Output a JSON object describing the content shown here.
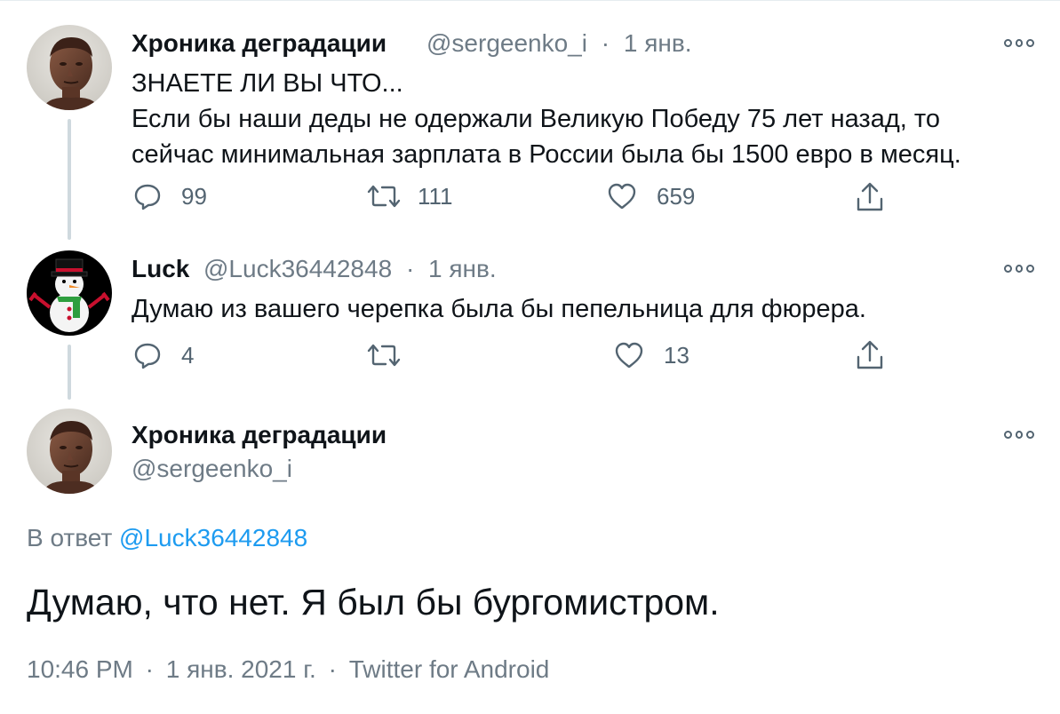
{
  "tweet1": {
    "author_name": "Хроника деградации",
    "handle": "@sergeenko_i",
    "separator": "·",
    "date": "1 янв.",
    "lines": [
      "ЗНАЕТЕ ЛИ ВЫ ЧТО...",
      "Если бы наши деды не одержали Великую Победу 75 лет назад, то",
      "сейчас минимальная зарплата в России была бы 1500 евро в месяц."
    ],
    "replies": "99",
    "retweets": "111",
    "likes": "659"
  },
  "tweet2": {
    "author_name": "Luck",
    "handle": "@Luck36442848",
    "separator": "·",
    "date": "1 янв.",
    "lines": [
      "Думаю из вашего черепка была бы пепельница для фюрера."
    ],
    "replies": "4",
    "retweets": "",
    "likes": "13"
  },
  "tweet3": {
    "author_name": "Хроника деградации",
    "handle": "@sergeenko_i",
    "reply_prefix": "В ответ",
    "reply_handle": "@Luck36442848",
    "text": "Думаю, что нет. Я был бы бургомистром.",
    "time": "10:46 PM",
    "date": "1 янв. 2021 г.",
    "client": "Twitter for Android",
    "separator": "·"
  },
  "colors": {
    "text": "#0f1419",
    "secondary": "#6e7b86",
    "link": "#1d9bf0",
    "thread_line": "#cfd9de"
  },
  "icons": [
    "more-icon",
    "reply-icon",
    "retweet-icon",
    "like-icon",
    "share-icon"
  ]
}
